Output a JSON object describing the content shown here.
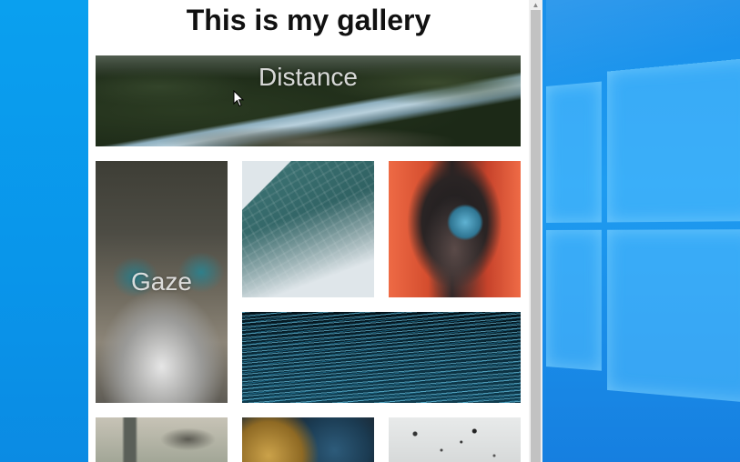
{
  "page": {
    "title": "This is my gallery"
  },
  "gallery": {
    "tiles": [
      {
        "id": "distance",
        "caption": "Distance"
      },
      {
        "id": "gaze",
        "caption": "Gaze"
      },
      {
        "id": "dome",
        "caption": ""
      },
      {
        "id": "orb",
        "caption": ""
      },
      {
        "id": "rings",
        "caption": ""
      },
      {
        "id": "room",
        "caption": ""
      },
      {
        "id": "gold",
        "caption": ""
      },
      {
        "id": "speckle",
        "caption": ""
      }
    ]
  },
  "icons": {
    "cursor": "mouse-pointer-icon",
    "scroll_up": "scroll-up-arrow-icon",
    "desktop_logo": "windows-logo-icon"
  },
  "colors": {
    "desktop_blue": "#0b96ee",
    "page_background": "#ffffff",
    "title_text": "#111111",
    "scrollbar_thumb": "#c2c2c2"
  }
}
